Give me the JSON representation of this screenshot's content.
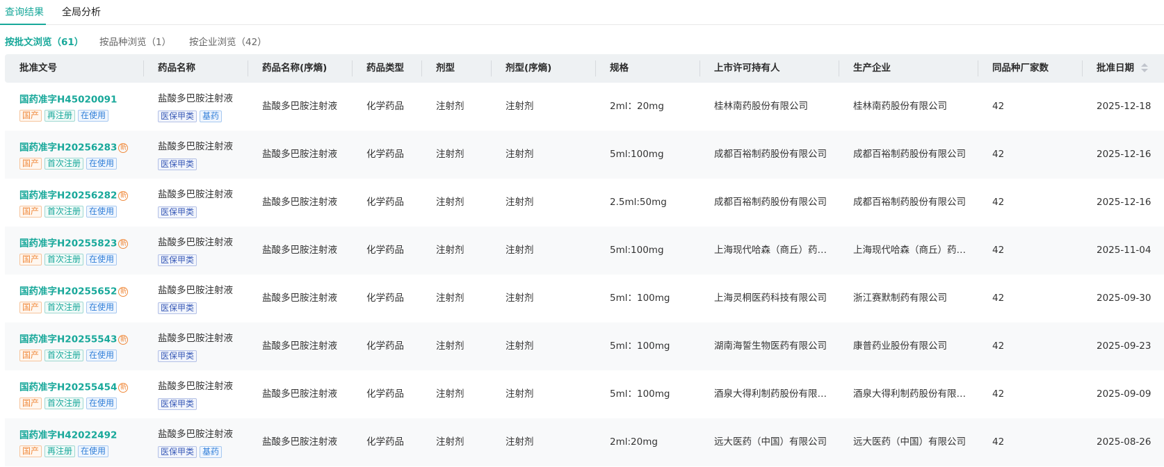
{
  "top_tabs": [
    "查询结果",
    "全局分析"
  ],
  "sub_tabs": [
    "按批文浏览（61）",
    "按品种浏览（1）",
    "按企业浏览（42）"
  ],
  "columns": [
    "批准文号",
    "药品名称",
    "药品名称(序熵)",
    "药品类型",
    "剂型",
    "剂型(序熵)",
    "规格",
    "上市许可持有人",
    "生产企业",
    "同品种厂家数",
    "批准日期"
  ],
  "new_icon_label": "新",
  "colors": {
    "accent": "#18a89a",
    "tag_orange": "#f08a3c",
    "tag_blue": "#2f7ed8",
    "tag_indigo": "#3a5bb8",
    "header_bg": "#eef1f3"
  },
  "rows": [
    {
      "approval_no": "国药准字H45020091",
      "is_new": false,
      "status_tags": [
        "国产",
        "再注册",
        "在使用"
      ],
      "drug_name": "盐酸多巴胺注射液",
      "name_tags": [
        "医保甲类",
        "基药"
      ],
      "drug_name_sort": "盐酸多巴胺注射液",
      "drug_type": "化学药品",
      "dosage_form": "注射剂",
      "dosage_form_sort": "注射剂",
      "spec": "2ml：20mg",
      "holder": "桂林南药股份有限公司",
      "manufacturer": "桂林南药股份有限公司",
      "same_count": "42",
      "approval_date": "2025-12-18"
    },
    {
      "approval_no": "国药准字H20256283",
      "is_new": true,
      "status_tags": [
        "国产",
        "首次注册",
        "在使用"
      ],
      "drug_name": "盐酸多巴胺注射液",
      "name_tags": [
        "医保甲类"
      ],
      "drug_name_sort": "盐酸多巴胺注射液",
      "drug_type": "化学药品",
      "dosage_form": "注射剂",
      "dosage_form_sort": "注射剂",
      "spec": "5ml:100mg",
      "holder": "成都百裕制药股份有限公司",
      "manufacturer": "成都百裕制药股份有限公司",
      "same_count": "42",
      "approval_date": "2025-12-16"
    },
    {
      "approval_no": "国药准字H20256282",
      "is_new": true,
      "status_tags": [
        "国产",
        "首次注册",
        "在使用"
      ],
      "drug_name": "盐酸多巴胺注射液",
      "name_tags": [
        "医保甲类"
      ],
      "drug_name_sort": "盐酸多巴胺注射液",
      "drug_type": "化学药品",
      "dosage_form": "注射剂",
      "dosage_form_sort": "注射剂",
      "spec": "2.5ml:50mg",
      "holder": "成都百裕制药股份有限公司",
      "manufacturer": "成都百裕制药股份有限公司",
      "same_count": "42",
      "approval_date": "2025-12-16"
    },
    {
      "approval_no": "国药准字H20255823",
      "is_new": true,
      "status_tags": [
        "国产",
        "首次注册",
        "在使用"
      ],
      "drug_name": "盐酸多巴胺注射液",
      "name_tags": [
        "医保甲类"
      ],
      "drug_name_sort": "盐酸多巴胺注射液",
      "drug_type": "化学药品",
      "dosage_form": "注射剂",
      "dosage_form_sort": "注射剂",
      "spec": "5ml:100mg",
      "holder": "上海现代哈森（商丘）药…",
      "manufacturer": "上海现代哈森（商丘）药…",
      "same_count": "42",
      "approval_date": "2025-11-04"
    },
    {
      "approval_no": "国药准字H20255652",
      "is_new": true,
      "status_tags": [
        "国产",
        "首次注册",
        "在使用"
      ],
      "drug_name": "盐酸多巴胺注射液",
      "name_tags": [
        "医保甲类"
      ],
      "drug_name_sort": "盐酸多巴胺注射液",
      "drug_type": "化学药品",
      "dosage_form": "注射剂",
      "dosage_form_sort": "注射剂",
      "spec": "5ml：100mg",
      "holder": "上海灵桐医药科技有限公司",
      "manufacturer": "浙江赛默制药有限公司",
      "same_count": "42",
      "approval_date": "2025-09-30"
    },
    {
      "approval_no": "国药准字H20255543",
      "is_new": true,
      "status_tags": [
        "国产",
        "首次注册",
        "在使用"
      ],
      "drug_name": "盐酸多巴胺注射液",
      "name_tags": [
        "医保甲类"
      ],
      "drug_name_sort": "盐酸多巴胺注射液",
      "drug_type": "化学药品",
      "dosage_form": "注射剂",
      "dosage_form_sort": "注射剂",
      "spec": "5ml：100mg",
      "holder": "湖南海誓生物医药有限公司",
      "manufacturer": "康普药业股份有限公司",
      "same_count": "42",
      "approval_date": "2025-09-23"
    },
    {
      "approval_no": "国药准字H20255454",
      "is_new": true,
      "status_tags": [
        "国产",
        "首次注册",
        "在使用"
      ],
      "drug_name": "盐酸多巴胺注射液",
      "name_tags": [
        "医保甲类"
      ],
      "drug_name_sort": "盐酸多巴胺注射液",
      "drug_type": "化学药品",
      "dosage_form": "注射剂",
      "dosage_form_sort": "注射剂",
      "spec": "5ml：100mg",
      "holder": "酒泉大得利制药股份有限…",
      "manufacturer": "酒泉大得利制药股份有限…",
      "same_count": "42",
      "approval_date": "2025-09-09"
    },
    {
      "approval_no": "国药准字H42022492",
      "is_new": false,
      "status_tags": [
        "国产",
        "再注册",
        "在使用"
      ],
      "drug_name": "盐酸多巴胺注射液",
      "name_tags": [
        "医保甲类",
        "基药"
      ],
      "drug_name_sort": "盐酸多巴胺注射液",
      "drug_type": "化学药品",
      "dosage_form": "注射剂",
      "dosage_form_sort": "注射剂",
      "spec": "2ml:20mg",
      "holder": "远大医药（中国）有限公司",
      "manufacturer": "远大医药（中国）有限公司",
      "same_count": "42",
      "approval_date": "2025-08-26"
    }
  ]
}
